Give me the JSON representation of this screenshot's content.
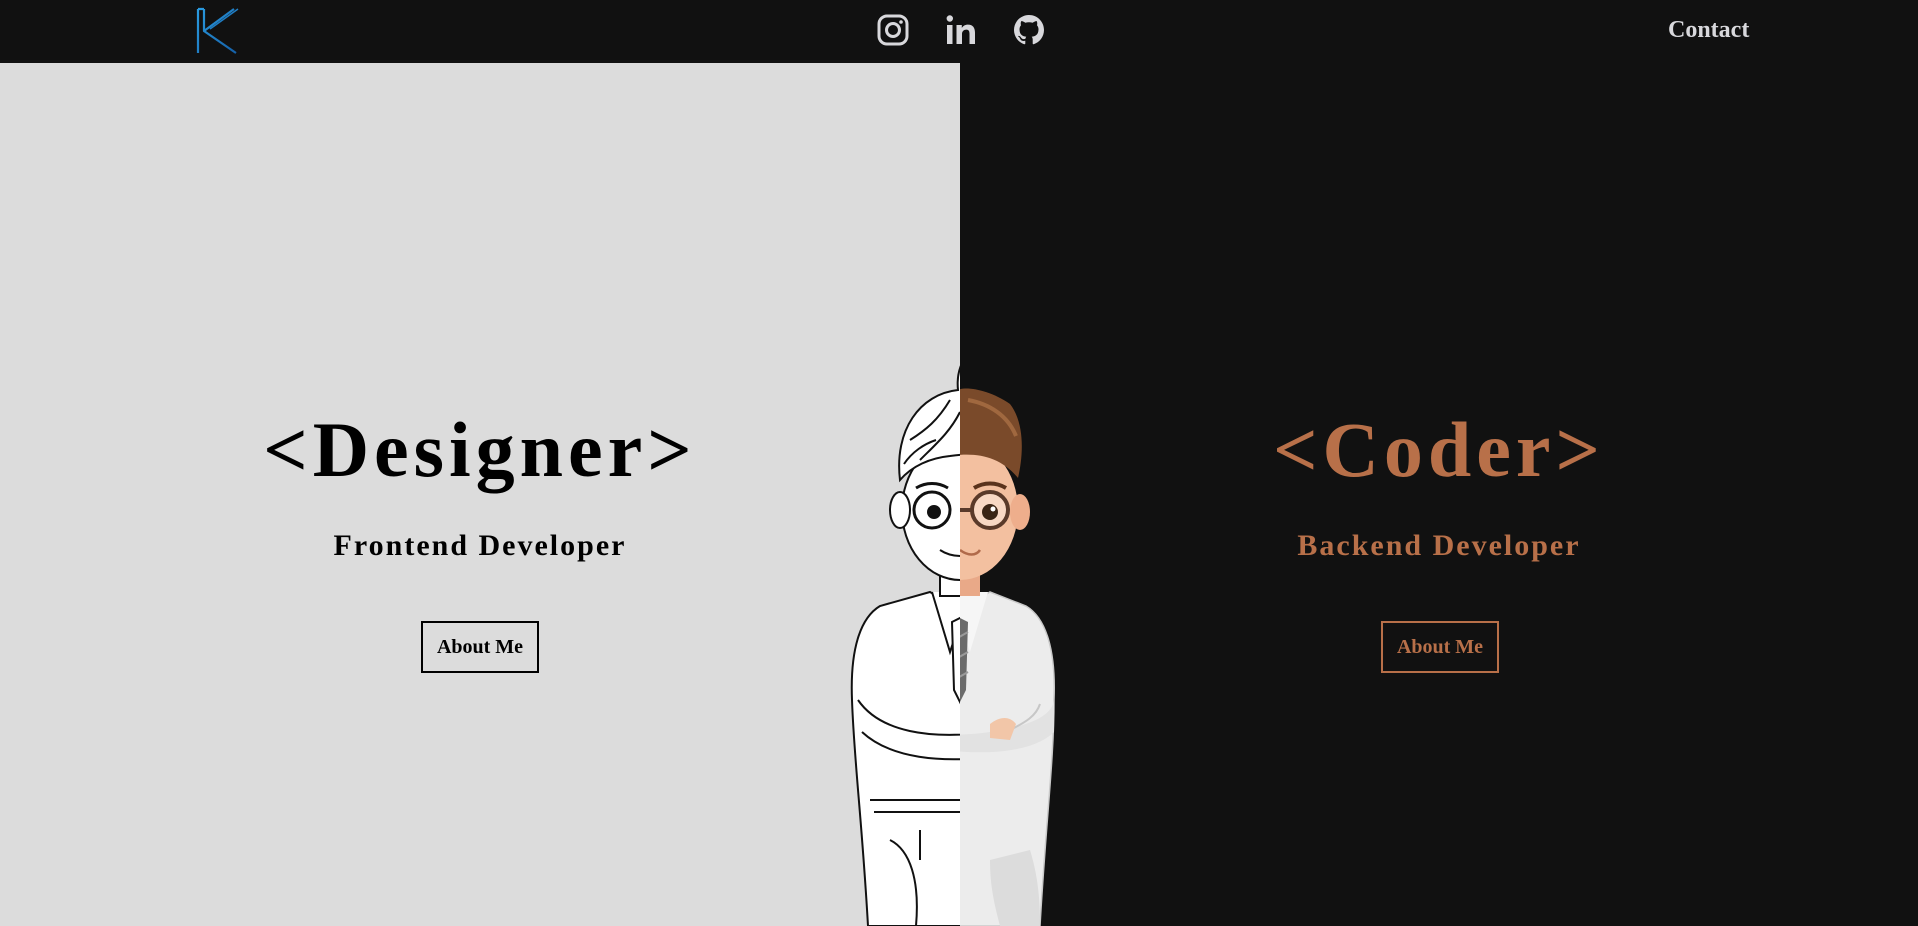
{
  "header": {
    "logo_letter": "K",
    "socials": [
      {
        "name": "instagram-icon"
      },
      {
        "name": "linkedin-icon"
      },
      {
        "name": "github-icon"
      }
    ],
    "contact_label": "Contact"
  },
  "left_panel": {
    "title": "<Designer>",
    "subtitle": "Frontend Developer",
    "button_label": "About Me"
  },
  "right_panel": {
    "title": "<Coder>",
    "subtitle": "Backend Developer",
    "button_label": "About Me"
  },
  "colors": {
    "header_bg": "#111111",
    "left_bg": "#dcdcdc",
    "right_bg": "#111111",
    "accent": "#b87049",
    "logo": "#1f7fc4",
    "icons": "#d8d8dc"
  }
}
